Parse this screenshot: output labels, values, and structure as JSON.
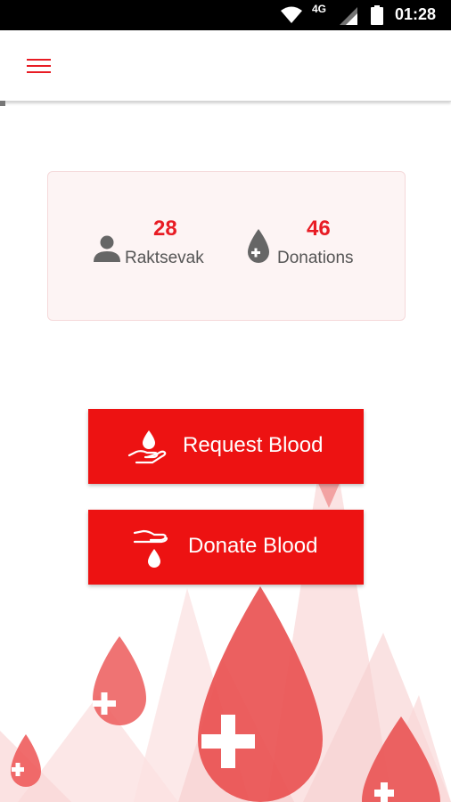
{
  "status_bar": {
    "network": "4G",
    "time": "01:28"
  },
  "app_bar": {
    "menu_icon": "hamburger-menu-icon"
  },
  "stats": {
    "raktsevak": {
      "count": "28",
      "label": "Raktsevak",
      "icon": "person-icon"
    },
    "donations": {
      "count": "46",
      "label": "Donations",
      "icon": "blood-drop-plus-icon"
    }
  },
  "actions": {
    "request": {
      "label": "Request Blood",
      "icon": "hand-drop-icon"
    },
    "donate": {
      "label": "Donate Blood",
      "icon": "donate-hand-drop-icon"
    }
  },
  "colors": {
    "accent": "#e81c24",
    "button": "#ed1212",
    "card_bg": "#fdf4f4"
  }
}
